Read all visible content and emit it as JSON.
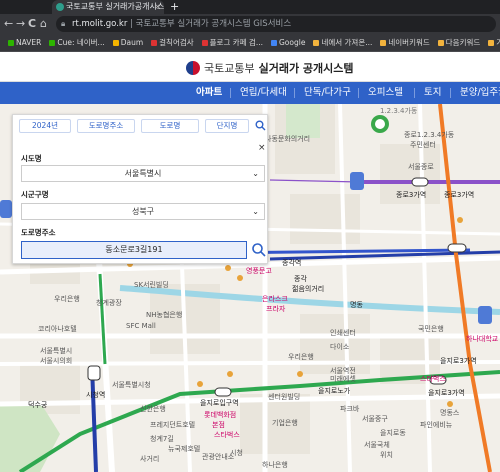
{
  "browser": {
    "tab_title": "국토교통부 실거래가공개시스템",
    "tab_close": "×",
    "new_tab": "+",
    "nav_back": "←",
    "nav_forward": "→",
    "nav_reload": "C",
    "nav_home": "⌂",
    "url_host": "rt.molit.go.kr",
    "url_title": "국토교통부 실거래가 공개시스템 GIS서비스",
    "bookmarks": [
      {
        "label": "NAVER",
        "color": "#2db400"
      },
      {
        "label": "Cue: 네이버...",
        "color": "#2db400"
      },
      {
        "label": "Daum",
        "color": "#f4b400"
      },
      {
        "label": "걸칙어검사",
        "color": "#d33"
      },
      {
        "label": "플로그 카페 검...",
        "color": "#d33"
      },
      {
        "label": "Google",
        "color": "#4285f4"
      },
      {
        "label": "네에서 가져온...",
        "color": "#f2b33d"
      },
      {
        "label": "네이버키워드",
        "color": "#f2b33d"
      },
      {
        "label": "다음키워드",
        "color": "#f2b33d"
      },
      {
        "label": "가비아",
        "color": "#f2b33d"
      }
    ]
  },
  "header": {
    "ministry": "국토교통부",
    "system": "실거래가 공개시스템"
  },
  "menu": [
    {
      "label": "아파트",
      "active": true
    },
    {
      "label": "연립/다세대"
    },
    {
      "label": "단독/다가구"
    },
    {
      "label": "오피스텔"
    },
    {
      "label": "토지"
    },
    {
      "label": "분양/입주권"
    }
  ],
  "panel": {
    "tabs": [
      "2024년",
      "도로명주소",
      "도로명",
      "단지명"
    ],
    "close": "×",
    "sido_label": "시도명",
    "sido_value": "서울특별시",
    "sigungu_label": "시군구명",
    "sigungu_value": "성북구",
    "road_label": "도로명주소",
    "road_value": "동소문로3길191"
  },
  "map": {
    "labels": [
      {
        "text": "1.2.3.4가동",
        "color": "#777"
      },
      {
        "text": "사동문화의거리",
        "color": "#555"
      },
      {
        "text": "종로1.2.3.4가동",
        "color": "#555"
      },
      {
        "text": "주민센터",
        "color": "#555"
      },
      {
        "text": "서울종로",
        "color": "#555"
      },
      {
        "text": "종로3가역",
        "color": "#222"
      },
      {
        "text": "종로3가역",
        "color": "#222"
      },
      {
        "text": "종각",
        "color": "#222"
      },
      {
        "text": "젊음의거리",
        "color": "#222"
      },
      {
        "text": "은라스크",
        "color": "#c06"
      },
      {
        "text": "프라자",
        "color": "#c06"
      },
      {
        "text": "종각역",
        "color": "#222"
      },
      {
        "text": "영풍문고",
        "color": "#c06"
      },
      {
        "text": "SK서린빌딩",
        "color": "#555"
      },
      {
        "text": "우리은행",
        "color": "#555"
      },
      {
        "text": "청계광장",
        "color": "#555"
      },
      {
        "text": "SFC Mall",
        "color": "#555"
      },
      {
        "text": "NH농협은행",
        "color": "#555"
      },
      {
        "text": "코리아나호텔",
        "color": "#555"
      },
      {
        "text": "서울특별시",
        "color": "#555"
      },
      {
        "text": "서울시의회",
        "color": "#555"
      },
      {
        "text": "서울특별시청",
        "color": "#555"
      },
      {
        "text": "덕수궁",
        "color": "#222"
      },
      {
        "text": "시청역",
        "color": "#222"
      },
      {
        "text": "을지로입구역",
        "color": "#222"
      },
      {
        "text": "롯데백화점",
        "color": "#c06"
      },
      {
        "text": "본점",
        "color": "#c06"
      },
      {
        "text": "을지로3가역",
        "color": "#222"
      },
      {
        "text": "을지로3가역",
        "color": "#222"
      },
      {
        "text": "을지로노가",
        "color": "#222"
      },
      {
        "text": "기업은행",
        "color": "#555"
      },
      {
        "text": "하나은행",
        "color": "#555"
      },
      {
        "text": "명동",
        "color": "#222"
      },
      {
        "text": "스타벅스",
        "color": "#c06"
      },
      {
        "text": "파크바",
        "color": "#555"
      },
      {
        "text": "서울중구",
        "color": "#555"
      },
      {
        "text": "을지로동",
        "color": "#555"
      },
      {
        "text": "인쇄센터",
        "color": "#555"
      },
      {
        "text": "다이소",
        "color": "#555"
      },
      {
        "text": "국민은행",
        "color": "#555"
      },
      {
        "text": "우리은행",
        "color": "#555"
      },
      {
        "text": "명동스",
        "color": "#555"
      },
      {
        "text": "신한은행",
        "color": "#555"
      },
      {
        "text": "프레지던트호텔",
        "color": "#555"
      },
      {
        "text": "서울국체",
        "color": "#555"
      },
      {
        "text": "위치",
        "color": "#555"
      },
      {
        "text": "파인에비뉴",
        "color": "#555"
      },
      {
        "text": "하나대학교",
        "color": "#c06"
      },
      {
        "text": "스타벅스",
        "color": "#c06"
      },
      {
        "text": "서울역전",
        "color": "#555"
      },
      {
        "text": "미래에셋",
        "color": "#555"
      },
      {
        "text": "센터원빌딩",
        "color": "#555"
      },
      {
        "text": "청계7길",
        "color": "#555"
      },
      {
        "text": "뉴국제호텔",
        "color": "#555"
      },
      {
        "text": "시청",
        "color": "#555"
      },
      {
        "text": "사거리",
        "color": "#555"
      },
      {
        "text": "관광안내소",
        "color": "#555"
      }
    ]
  }
}
